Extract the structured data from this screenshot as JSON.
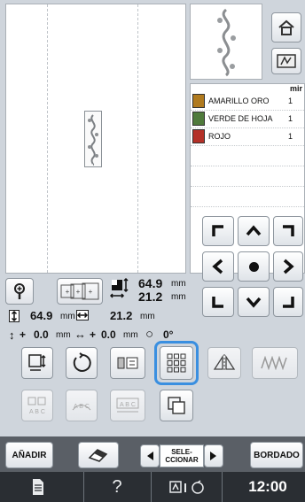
{
  "thread_list": [
    {
      "name": "AMARILLO ORO",
      "count": "1"
    },
    {
      "name": "VERDE DE HOJA",
      "count": "1"
    },
    {
      "name": "ROJO",
      "count": "1"
    }
  ],
  "thread_header_suffix": "mir",
  "size": {
    "width_value": "64.9",
    "height_value": "21.2",
    "unit": "mm"
  },
  "dims_row": {
    "width_value": "64.9",
    "height_value": "21.2",
    "unit": "mm"
  },
  "offset_row": {
    "y_value": "0.0",
    "x_value": "0.0",
    "unit": "mm",
    "angle": "0°",
    "plus": "+"
  },
  "bottom_bar": {
    "add_label": "AÑADIR",
    "select_label_1": "SELE-",
    "select_label_2": "CCIONAR",
    "embroidery_label": "BORDADO"
  },
  "status_bar": {
    "help_label": "?",
    "time": "12:00"
  },
  "icons": {
    "home": "home-icon",
    "mode": "embroidery-mode-icon",
    "magnify": "magnifier-icon",
    "frame": "frame-size-icon",
    "size_toggle": "size-toggle-icon",
    "rotate": "rotate-icon",
    "array": "array-icon",
    "duplicate": "duplicate-icon",
    "mirror": "mirror-icon",
    "density": "density-icon",
    "eraser": "eraser-icon",
    "left_arrow": "left-arrow-icon",
    "right_arrow": "right-arrow-icon",
    "document": "document-icon",
    "wifi": "wireless-icon"
  },
  "colors": {
    "accent_highlight": "#3a8fe0",
    "thread_gold": "#b07a1e",
    "thread_green": "#4f7a3b",
    "thread_red": "#b43128"
  }
}
